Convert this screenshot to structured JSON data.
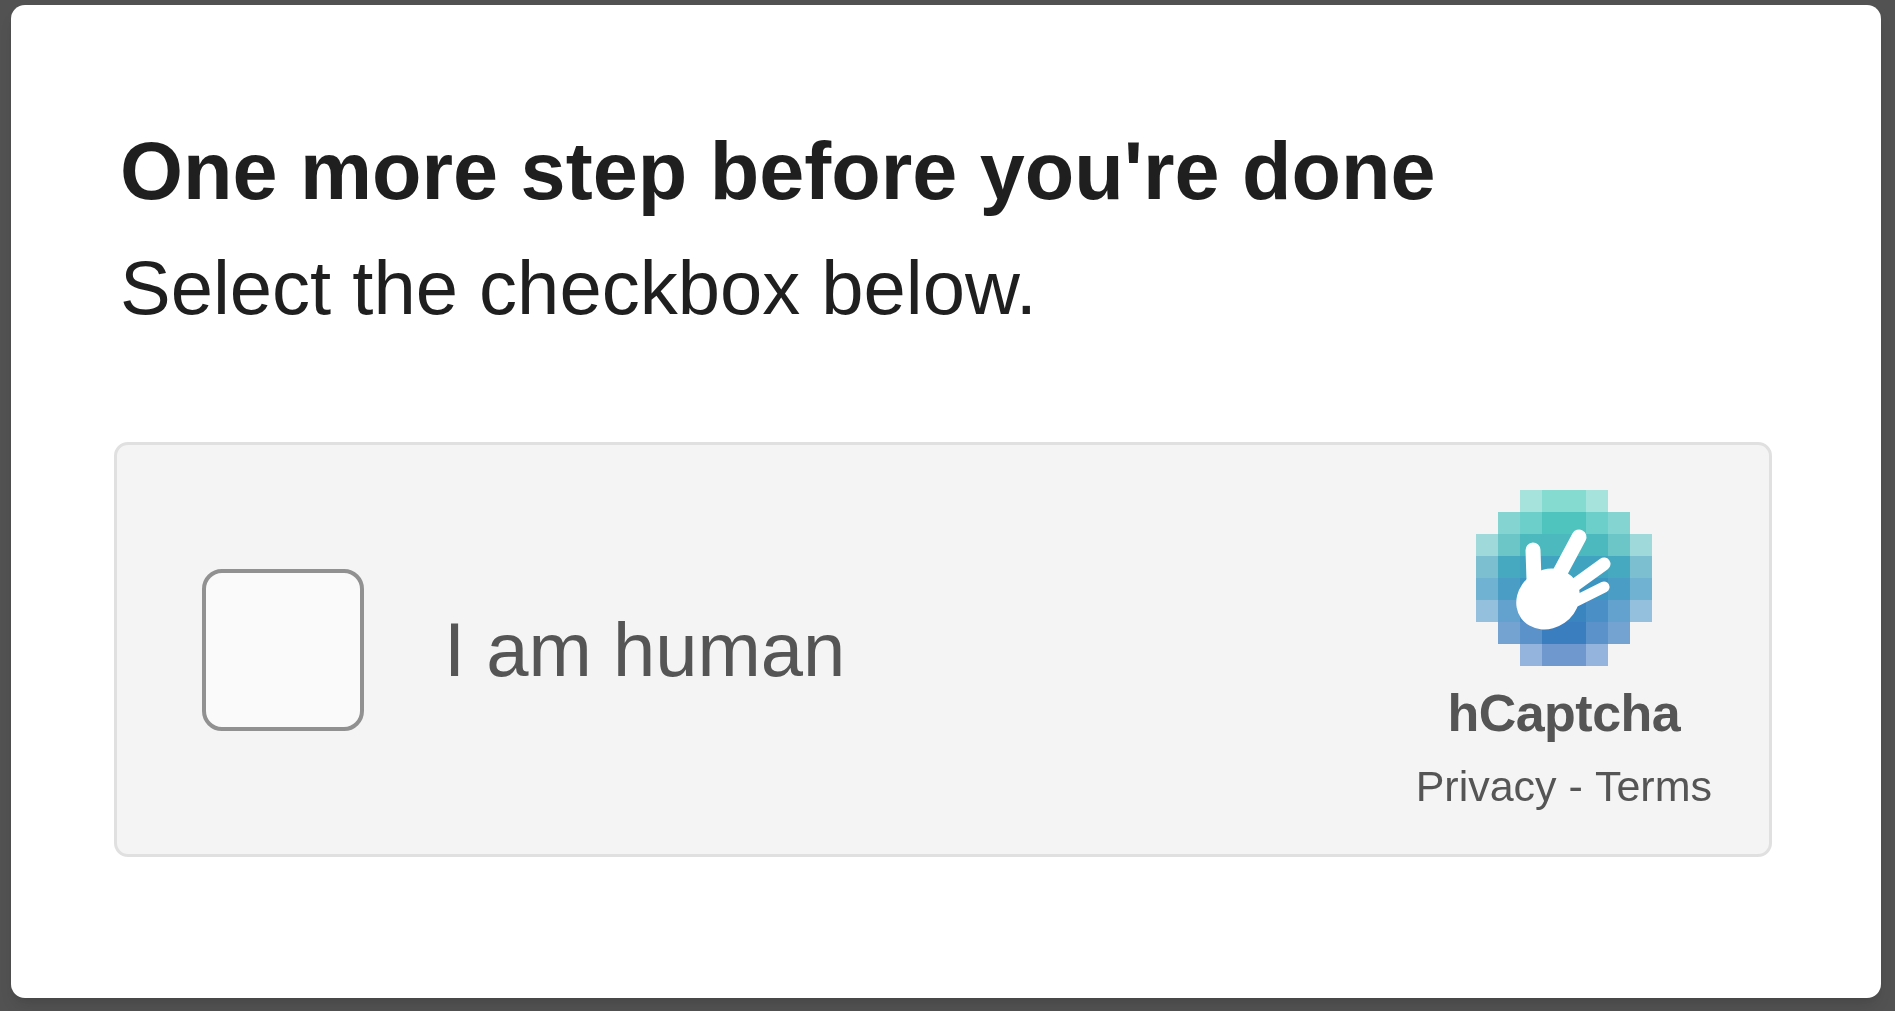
{
  "dialog": {
    "title": "One more step before you're done",
    "instruction": "Select the checkbox below.",
    "captcha": {
      "checkbox": {
        "label": "I am human",
        "checked": false
      },
      "brand": "hCaptcha",
      "links": [
        {
          "label": "Privacy"
        },
        {
          "label": "Terms"
        }
      ],
      "separator": "-"
    }
  }
}
